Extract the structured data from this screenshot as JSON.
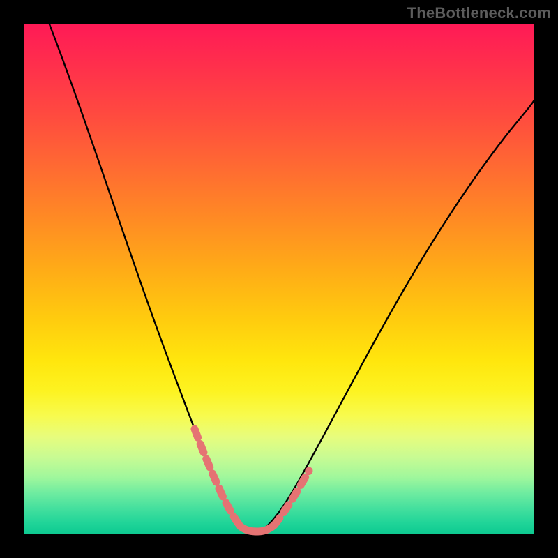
{
  "watermark": "TheBottleneck.com",
  "colors": {
    "background": "#000000",
    "curve": "#000000",
    "highlight": "#e57373",
    "watermark": "#5c5c5c"
  },
  "chart_data": {
    "type": "line",
    "title": "",
    "xlabel": "",
    "ylabel": "",
    "xlim": [
      0,
      100
    ],
    "ylim": [
      0,
      100
    ],
    "grid": false,
    "series": [
      {
        "name": "bottleneck-curve",
        "x": [
          5,
          10,
          15,
          20,
          25,
          30,
          33,
          36,
          38,
          40,
          42,
          44,
          46,
          48,
          50,
          55,
          60,
          65,
          70,
          75,
          80,
          85,
          90,
          95,
          100
        ],
        "values": [
          100,
          86,
          72,
          58,
          45,
          32,
          23,
          14,
          9,
          5,
          2,
          1,
          1,
          2,
          5,
          12,
          20,
          28,
          36,
          44,
          51,
          58,
          65,
          72,
          78
        ]
      }
    ],
    "annotations": [
      {
        "name": "highlight-left",
        "x_range": [
          33,
          40
        ],
        "style": "dashed-pink"
      },
      {
        "name": "highlight-right",
        "x_range": [
          48,
          52
        ],
        "style": "dashed-pink"
      },
      {
        "name": "valley-floor",
        "x_range": [
          40,
          48
        ],
        "style": "solid-pink"
      }
    ]
  }
}
